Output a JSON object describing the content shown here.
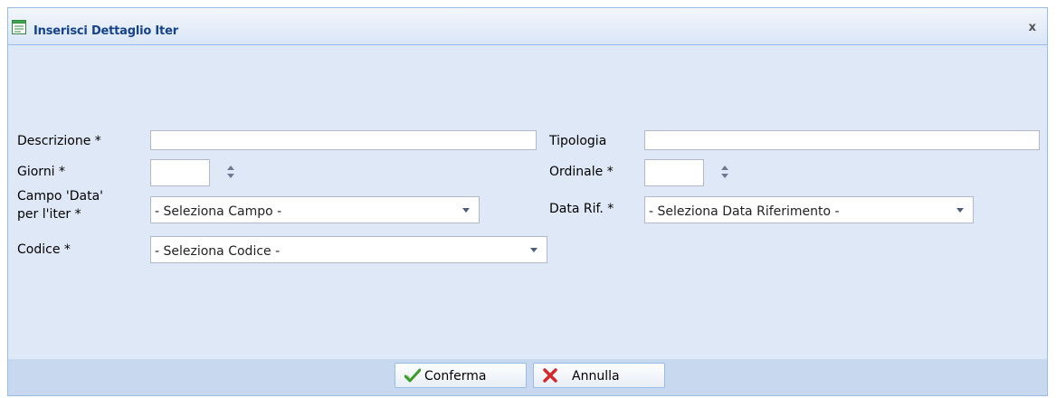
{
  "window": {
    "title": "Inserisci Dettaglio Iter",
    "close_label": "x"
  },
  "form": {
    "descrizione_label": "Descrizione *",
    "descrizione_value": "",
    "tipologia_label": "Tipologia",
    "tipologia_value": "",
    "giorni_label": "Giorni *",
    "giorni_value": "",
    "ordinale_label": "Ordinale *",
    "ordinale_value": "",
    "campo_label_line1": "Campo 'Data'",
    "campo_label_line2": "per l'iter *",
    "campo_selected": "- Seleziona Campo -",
    "datarif_label": "Data Rif. *",
    "datarif_selected": "- Seleziona Data Riferimento -",
    "codice_label": "Codice *",
    "codice_selected": "- Seleziona Codice -"
  },
  "buttons": {
    "confirm_label": "Conferma",
    "cancel_label": "Annulla"
  },
  "icons": {
    "title": "form-icon",
    "close": "close-icon",
    "spinner": "spinner-arrows-icon",
    "combo": "chevron-down-icon",
    "confirm": "check-icon",
    "cancel": "x-icon"
  },
  "colors": {
    "title_text": "#15428b",
    "panel_bg": "#dfe8f6",
    "border": "#99bbe8",
    "footer_bg": "#c7d8ef"
  }
}
